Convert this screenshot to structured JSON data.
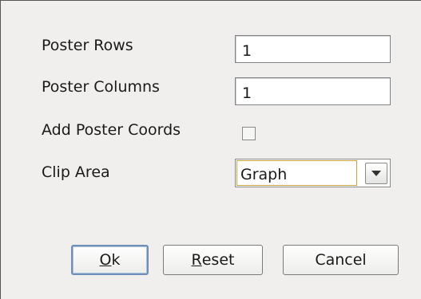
{
  "form": {
    "poster_rows": {
      "label": "Poster Rows",
      "value": "1"
    },
    "poster_columns": {
      "label": "Poster Columns",
      "value": "1"
    },
    "add_poster_coords": {
      "label": "Add Poster Coords",
      "checked": false
    },
    "clip_area": {
      "label": "Clip Area",
      "selected": "Graph"
    }
  },
  "buttons": {
    "ok": {
      "mnemonic": "O",
      "rest": "k"
    },
    "reset": {
      "mnemonic": "R",
      "rest": "eset"
    },
    "cancel": {
      "label": "Cancel"
    }
  },
  "colors": {
    "dialog_bg": "#f0efed",
    "focus_border": "#c9a441",
    "default_button_border": "#6e8fb8"
  }
}
